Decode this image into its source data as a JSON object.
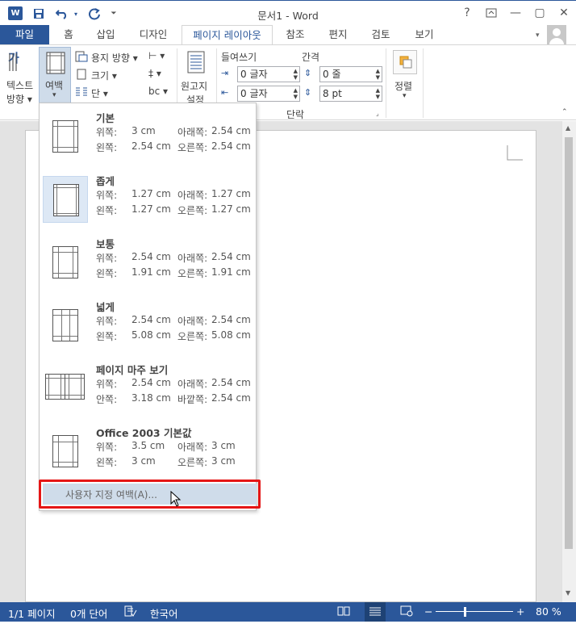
{
  "window": {
    "title": "문서1 - Word",
    "controls": {
      "help": "?",
      "minimize": "—",
      "maximize": "▢",
      "close": "✕"
    }
  },
  "qat": {
    "logo": "W",
    "save_icon": "save-icon",
    "undo_icon": "undo-icon",
    "redo_icon": "redo-icon",
    "customize_glyph": "⏷"
  },
  "tabs": [
    "파일",
    "홈",
    "삽입",
    "디자인",
    "페이지 레이아웃",
    "참조",
    "편지",
    "검토",
    "보기"
  ],
  "active_tab": "페이지 레이아웃",
  "ribbon": {
    "text_direction": {
      "line1": "텍스트",
      "line2": "방향 ▾",
      "glyph": "가"
    },
    "margins": {
      "label": "여백",
      "arrow": "▾"
    },
    "orientation": "용지 방향 ▾",
    "size": "크기 ▾",
    "columns": "단 ▾",
    "breaks_glyph": "⊢ ▾",
    "line_numbers_glyph": "‡ ▾",
    "hyphenation_glyph": "bc ▾",
    "draft": {
      "line1": "원고지",
      "line2": "설정"
    },
    "indent": {
      "header": "들여쓰기",
      "left": "0 글자",
      "right": "0 글자"
    },
    "spacing": {
      "header": "간격",
      "before": "0 줄",
      "after": "8 pt"
    },
    "paragraph_group": "단락",
    "arrange": {
      "label": "정렬",
      "arrow": "▾"
    }
  },
  "margins_menu": {
    "options": [
      {
        "name": "기본",
        "r1l": "위쪽:",
        "r1v": "3 cm",
        "r1r": "아래쪽:",
        "r1rv": "2.54 cm",
        "r2l": "왼쪽:",
        "r2v": "2.54 cm",
        "r2r": "오른쪽:",
        "r2rv": "2.54 cm"
      },
      {
        "name": "좁게",
        "r1l": "위쪽:",
        "r1v": "1.27 cm",
        "r1r": "아래쪽:",
        "r1rv": "1.27 cm",
        "r2l": "왼쪽:",
        "r2v": "1.27 cm",
        "r2r": "오른쪽:",
        "r2rv": "1.27 cm"
      },
      {
        "name": "보통",
        "r1l": "위쪽:",
        "r1v": "2.54 cm",
        "r1r": "아래쪽:",
        "r1rv": "2.54 cm",
        "r2l": "왼쪽:",
        "r2v": "1.91 cm",
        "r2r": "오른쪽:",
        "r2rv": "1.91 cm"
      },
      {
        "name": "넓게",
        "r1l": "위쪽:",
        "r1v": "2.54 cm",
        "r1r": "아래쪽:",
        "r1rv": "2.54 cm",
        "r2l": "왼쪽:",
        "r2v": "5.08 cm",
        "r2r": "오른쪽:",
        "r2rv": "5.08 cm"
      },
      {
        "name": "페이지 마주 보기",
        "r1l": "위쪽:",
        "r1v": "2.54 cm",
        "r1r": "아래쪽:",
        "r1rv": "2.54 cm",
        "r2l": "안쪽:",
        "r2v": "3.18 cm",
        "r2r": "바깥쪽:",
        "r2rv": "2.54 cm"
      },
      {
        "name": "Office 2003 기본값",
        "r1l": "위쪽:",
        "r1v": "3.5 cm",
        "r1r": "아래쪽:",
        "r1rv": "3 cm",
        "r2l": "왼쪽:",
        "r2v": "3 cm",
        "r2r": "오른쪽:",
        "r2rv": "3 cm"
      }
    ],
    "custom": "사용자 지정 여백(A)..."
  },
  "status": {
    "page": "1/1 페이지",
    "words": "0개 단어",
    "language": "한국어",
    "zoom_minus": "−",
    "zoom_plus": "+",
    "zoom": "80 %"
  },
  "colors": {
    "accent": "#2b579a",
    "highlight": "#e51616"
  }
}
